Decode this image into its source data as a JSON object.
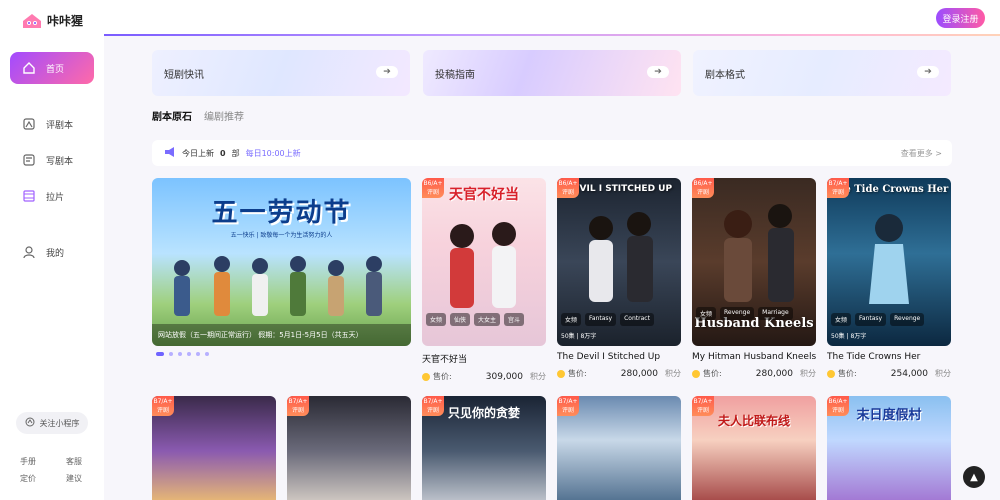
{
  "app": {
    "name": "咔咔猩",
    "login_label": "登录注册"
  },
  "sidebar": {
    "items": [
      {
        "label": "首页",
        "icon": "home-icon"
      },
      {
        "label": "评剧本",
        "icon": "review-icon"
      },
      {
        "label": "写剧本",
        "icon": "write-icon"
      },
      {
        "label": "拉片",
        "icon": "film-icon"
      },
      {
        "label": "我的",
        "icon": "user-icon"
      }
    ],
    "mini_program": "关注小程序",
    "footer_links": [
      "手册",
      "客服",
      "定价",
      "建议"
    ]
  },
  "cards": [
    {
      "label": "短剧快讯"
    },
    {
      "label": "投稿指南"
    },
    {
      "label": "剧本格式"
    }
  ],
  "tabs": [
    "剧本原石",
    "编剧推荐"
  ],
  "notice": {
    "prefix": "今日上新",
    "count": "0",
    "unit": "部",
    "schedule": "每日10:00上新",
    "more": "查看更多 >"
  },
  "banner": {
    "title": "五一劳动节",
    "subtitle": "五一快乐 | 致敬每一个为生活努力的人",
    "caption": "网站放假（五一期间正常运行） 假期：5月1日-5月5日（共五天）"
  },
  "books_row1": [
    {
      "grade": "B6/A+ 评剧",
      "cover_title": "天官不好当",
      "tags": [
        "女频",
        "仙侠",
        "大女主",
        "宫斗"
      ],
      "title": "天官不好当",
      "price_label": "售价:",
      "price": "309,000",
      "unit": "积分",
      "stats": ""
    },
    {
      "grade": "B6/A+ 评剧",
      "cover_title": "DEVIL I STITCHED UP",
      "tags": [
        "女频",
        "Fantasy",
        "Contract"
      ],
      "stats": "50集 | 8万字",
      "title": "The Devil I Stitched Up",
      "price_label": "售价:",
      "price": "280,000",
      "unit": "积分"
    },
    {
      "grade": "B6/A+ 评剧",
      "cover_title": "Husband Kneels",
      "tags": [
        "女频",
        "Revenge",
        "Marriage"
      ],
      "stats": "",
      "title": "My Hitman Husband Kneels",
      "price_label": "售价:",
      "price": "280,000",
      "unit": "积分"
    },
    {
      "grade": "B7/A+ 评剧",
      "cover_title": "The Tide Crowns Her",
      "tags": [
        "女频",
        "Fantasy",
        "Revenge"
      ],
      "stats": "50集 | 8万字",
      "title": "The Tide Crowns Her",
      "price_label": "售价:",
      "price": "254,000",
      "unit": "积分"
    }
  ],
  "books_row2": [
    {
      "grade": "B7/A+ 评剧",
      "cover_title": ""
    },
    {
      "grade": "B7/A+ 评剧",
      "cover_title": ""
    },
    {
      "grade": "B7/A+ 评剧",
      "cover_title": "只见你的贪婪"
    },
    {
      "grade": "B7/A+ 评剧",
      "cover_title": ""
    },
    {
      "grade": "B7/A+ 评剧",
      "cover_title": "夫人比联布线"
    },
    {
      "grade": "B6/A+ 评剧",
      "cover_title": "末日度假村"
    }
  ],
  "colors": {
    "accent": "#9b4dff",
    "accent2": "#ff5aa5",
    "coin": "#ffc733",
    "grade": "#ff5a4a"
  }
}
